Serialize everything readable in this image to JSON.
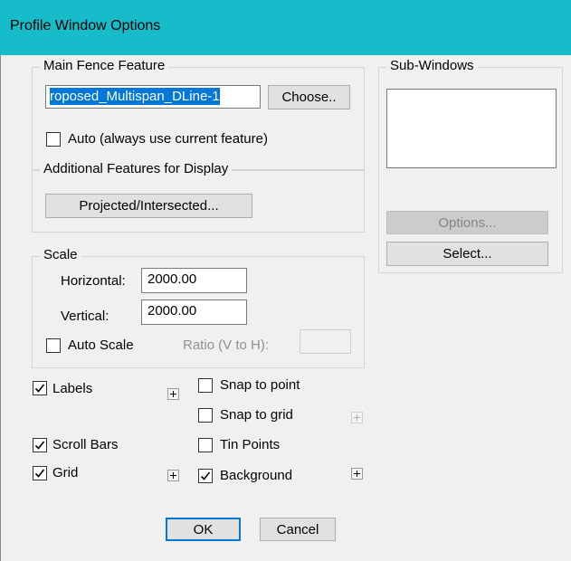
{
  "window": {
    "title": "Profile Window Options"
  },
  "main_fence": {
    "group_label": "Main Fence Feature",
    "feature_value": "roposed_Multispan_DLine-1",
    "choose_label": "Choose..",
    "auto_label": "Auto (always use current feature)",
    "auto_checked": false
  },
  "additional": {
    "group_label": "Additional Features for Display",
    "projected_label": "Projected/Intersected..."
  },
  "scale": {
    "group_label": "Scale",
    "horizontal_label": "Horizontal:",
    "horizontal_value": "2000.00",
    "vertical_label": "Vertical:",
    "vertical_value": "2000.00",
    "auto_scale_label": "Auto Scale",
    "auto_scale_checked": false,
    "ratio_label": "Ratio (V to H):",
    "ratio_value": ""
  },
  "sub_windows": {
    "group_label": "Sub-Windows",
    "items": [],
    "options_label": "Options...",
    "select_label": "Select..."
  },
  "display_options": {
    "labels": {
      "label": "Labels",
      "checked": true
    },
    "scroll_bars": {
      "label": "Scroll Bars",
      "checked": true
    },
    "grid": {
      "label": "Grid",
      "checked": true
    },
    "snap_to_point": {
      "label": "Snap to point",
      "checked": false
    },
    "snap_to_grid": {
      "label": "Snap to grid",
      "checked": false
    },
    "tin_points": {
      "label": "Tin Points",
      "checked": false
    },
    "background": {
      "label": "Background",
      "checked": true
    }
  },
  "footer": {
    "ok_label": "OK",
    "cancel_label": "Cancel"
  }
}
